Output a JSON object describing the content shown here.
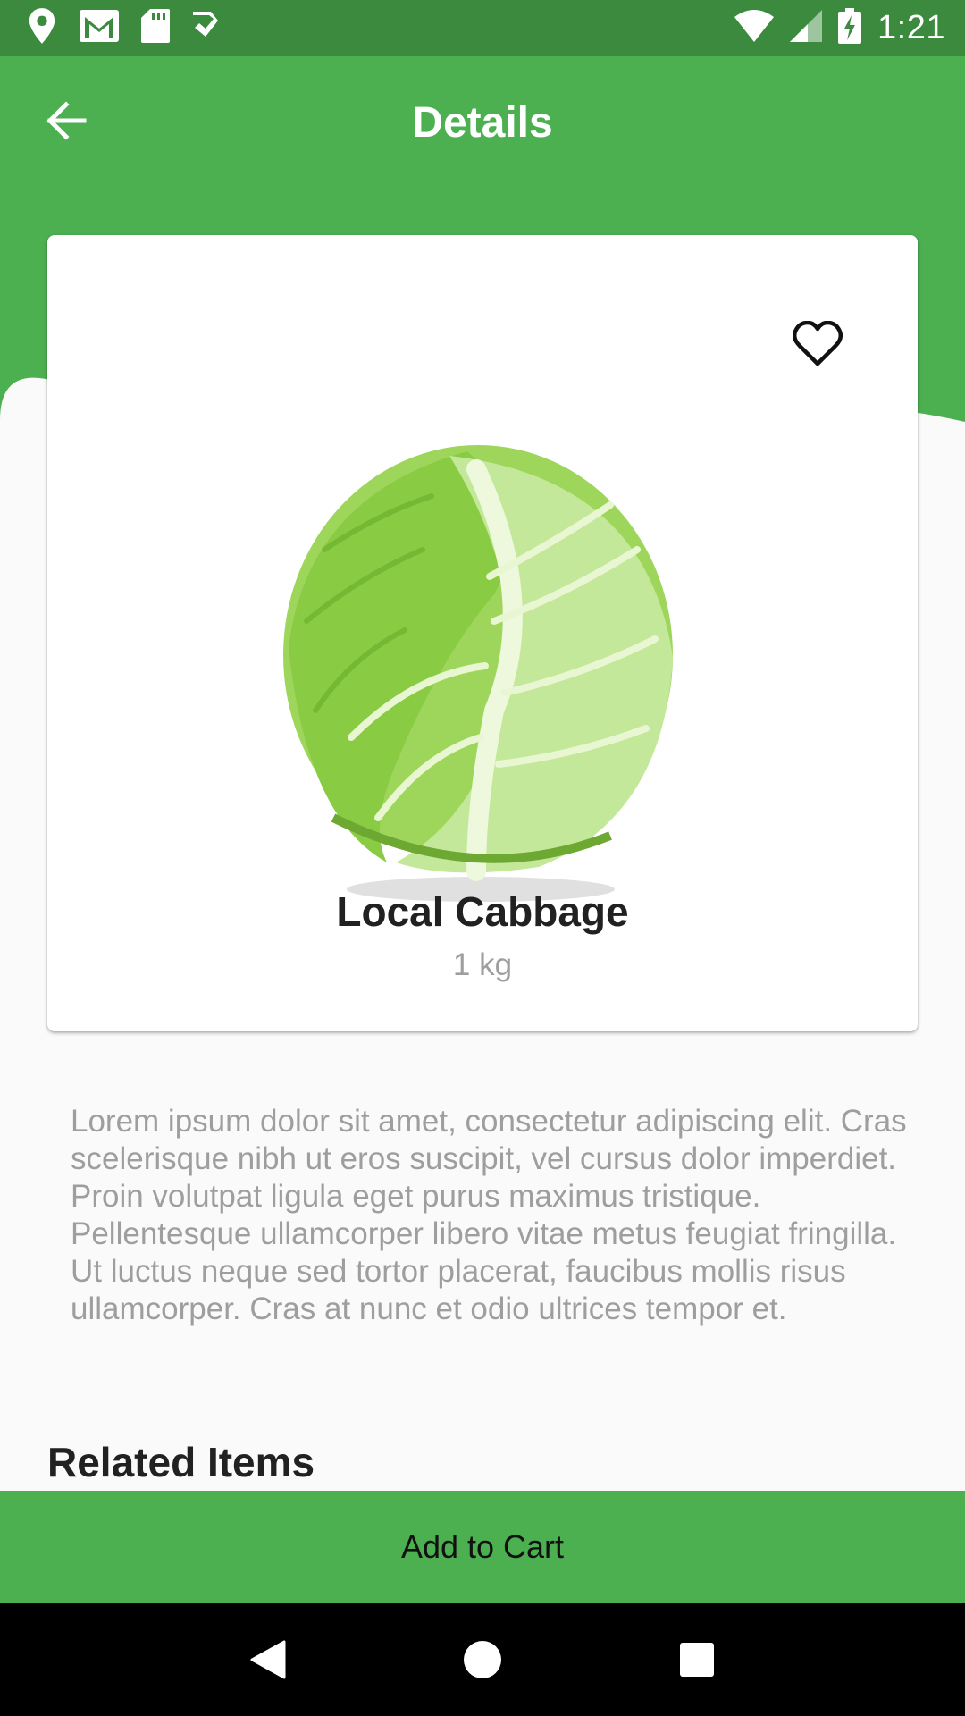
{
  "status_bar": {
    "time": "1:21",
    "left_icons": [
      "location-icon",
      "gmail-icon",
      "sd-card-icon",
      "check-icon"
    ],
    "right_icons": [
      "wifi-icon",
      "signal-icon",
      "battery-charging-icon"
    ]
  },
  "app_bar": {
    "title": "Details",
    "back_icon": "arrow-back-icon"
  },
  "product": {
    "name": "Local Cabbage",
    "quantity": "1 kg",
    "image": "cabbage-image",
    "favorite_icon": "heart-outline-icon",
    "description": "Lorem ipsum dolor sit amet, consectetur adipiscing elit. Cras scelerisque nibh ut eros suscipit, vel cursus dolor imperdiet. Proin volutpat ligula eget purus maximus tristique. Pellentesque ullamcorper libero vitae metus feugiat fringilla. Ut luctus neque sed tortor placerat, faucibus mollis risus ullamcorper. Cras at nunc et odio ultrices tempor et."
  },
  "related": {
    "title": "Related Items"
  },
  "actions": {
    "add_to_cart": "Add to Cart"
  },
  "nav_bar": {
    "buttons": [
      "back-triangle-icon",
      "home-circle-icon",
      "recents-square-icon"
    ]
  },
  "colors": {
    "primary": "#4caf50",
    "status_bar": "#3b8a3e",
    "background": "#fafafa",
    "text_primary": "#212121",
    "text_secondary": "#9e9e9e"
  }
}
